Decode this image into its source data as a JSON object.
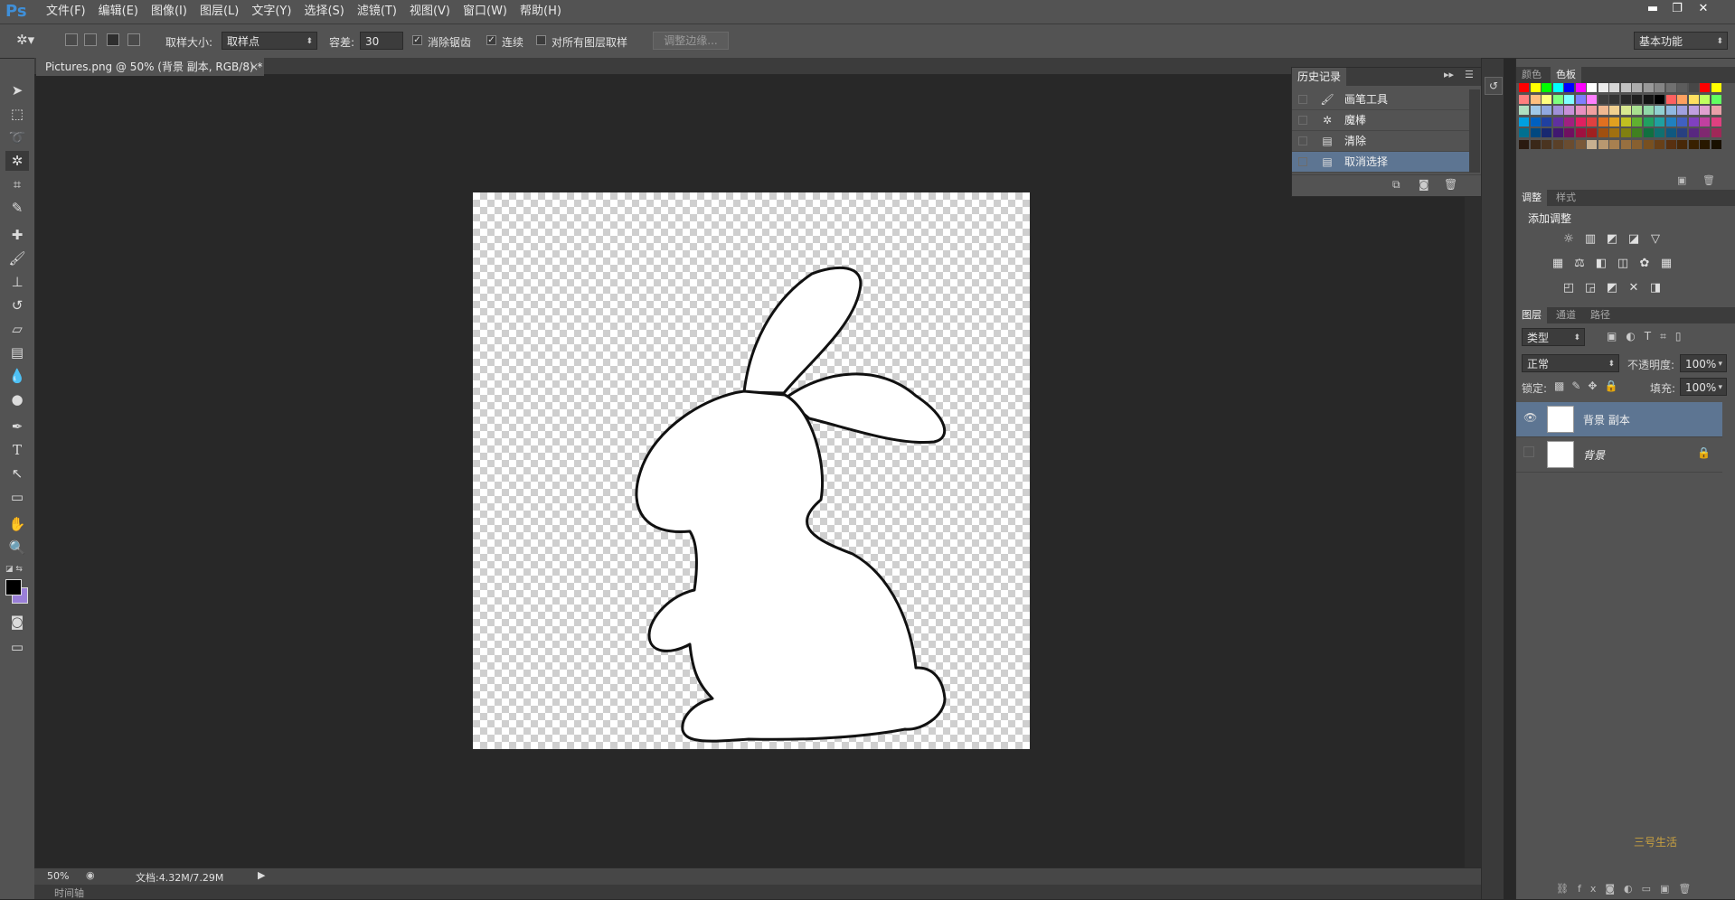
{
  "app": {
    "logo": "Ps",
    "workspace": "基本功能"
  },
  "menu": [
    "文件(F)",
    "编辑(E)",
    "图像(I)",
    "图层(L)",
    "文字(Y)",
    "选择(S)",
    "滤镜(T)",
    "视图(V)",
    "窗口(W)",
    "帮助(H)"
  ],
  "window_controls": {
    "minimize": "▬",
    "restore": "❐",
    "close": "✕"
  },
  "options": {
    "sample_size_label": "取样大小:",
    "sample_size_value": "取样点",
    "tolerance_label": "容差:",
    "tolerance_value": "30",
    "antialias_label": "消除锯齿",
    "antialias_checked": "✓",
    "contiguous_label": "连续",
    "contiguous_checked": "✓",
    "all_layers_label": "对所有图层取样",
    "refine_edge_label": "调整边缘..."
  },
  "document": {
    "tab_title": "Pictures.png @ 50% (背景 副本, RGB/8) *",
    "close": "×",
    "zoom": "50%",
    "doc_size": "文档:4.32M/7.29M",
    "timeline_label": "时间轴"
  },
  "tools": [
    "move-tool",
    "marquee-tool",
    "lasso-tool",
    "magic-wand-tool",
    "crop-tool",
    "eyedropper-tool",
    "healing-tool",
    "brush-tool",
    "stamp-tool",
    "history-brush-tool",
    "eraser-tool",
    "gradient-tool",
    "blur-tool",
    "dodge-tool",
    "pen-tool",
    "type-tool",
    "path-select-tool",
    "shape-tool",
    "hand-tool",
    "zoom-tool"
  ],
  "history": {
    "title": "历史记录",
    "items": [
      {
        "label": "画笔工具",
        "icon": "brush-icon",
        "selected": false
      },
      {
        "label": "魔棒",
        "icon": "wand-icon",
        "selected": false
      },
      {
        "label": "清除",
        "icon": "doc-icon",
        "selected": false
      },
      {
        "label": "取消选择",
        "icon": "doc-icon",
        "selected": true
      }
    ]
  },
  "color_panel": {
    "tab_color": "颜色",
    "tab_swatches": "色板"
  },
  "swatches": [
    [
      "#ff0000",
      "#ffff00",
      "#00ff00",
      "#00ffff",
      "#0000ff",
      "#ff00ff",
      "#ffffff",
      "#ebebeb",
      "#d6d6d6",
      "#c2c2c2",
      "#adadad",
      "#999999",
      "#858585",
      "#707070",
      "#5c5c5c",
      "#474747",
      "#ff0000",
      "#ffff00"
    ],
    [
      "#ff7f7f",
      "#ffbf7f",
      "#ffff7f",
      "#7fff7f",
      "#7fffff",
      "#7f7fff",
      "#ff7fff",
      "#3d3d3d",
      "#333333",
      "#292929",
      "#1f1f1f",
      "#141414",
      "#000000",
      "#ff6060",
      "#ffa060",
      "#ffe060",
      "#c0ff60",
      "#60ff60"
    ],
    [
      "#b0e0c0",
      "#a0c8e8",
      "#90a8e0",
      "#a090d8",
      "#c890d8",
      "#e890c0",
      "#f0a0a0",
      "#f0b890",
      "#f0d090",
      "#d8e890",
      "#a8e090",
      "#90d8a8",
      "#90d0d0",
      "#90b8e0",
      "#a0a0e0",
      "#c0a0e0",
      "#e0a0d0",
      "#e8a0a8"
    ],
    [
      "#00a0e0",
      "#0060c0",
      "#2040a0",
      "#6030a0",
      "#a02080",
      "#e02060",
      "#e04040",
      "#e07020",
      "#e0a020",
      "#c0c020",
      "#60b030",
      "#20a060",
      "#20a0a0",
      "#2080c0",
      "#4060c0",
      "#8040c0",
      "#c040a0",
      "#e04080"
    ],
    [
      "#007090",
      "#004880",
      "#182870",
      "#401870",
      "#701060",
      "#a01040",
      "#a02020",
      "#a05010",
      "#a07010",
      "#808010",
      "#408020",
      "#107040",
      "#107070",
      "#105880",
      "#284080",
      "#582880",
      "#802870",
      "#a02858"
    ],
    [
      "#2a1a10",
      "#3a2818",
      "#4a3420",
      "#5a4028",
      "#6a4c30",
      "#7a5838",
      "#c8b090",
      "#b89870",
      "#a88050",
      "#987040",
      "#886030",
      "#785020",
      "#684018",
      "#583010",
      "#482808",
      "#382000",
      "#281800",
      "#181000"
    ]
  ],
  "adjustments": {
    "tab_adjust": "调整",
    "tab_styles": "样式",
    "add_label": "添加调整"
  },
  "layers_panel": {
    "tab_layers": "图层",
    "tab_channels": "通道",
    "tab_paths": "路径",
    "filter_kind": "类型",
    "blend_mode": "正常",
    "opacity_label": "不透明度:",
    "opacity_value": "100%",
    "lock_label": "锁定:",
    "fill_label": "填充:",
    "fill_value": "100%",
    "layers": [
      {
        "name": "背景 副本",
        "visible": true,
        "selected": true,
        "locked": false
      },
      {
        "name": "背景",
        "visible": false,
        "selected": false,
        "locked": true
      }
    ]
  },
  "watermark": "三号生活"
}
